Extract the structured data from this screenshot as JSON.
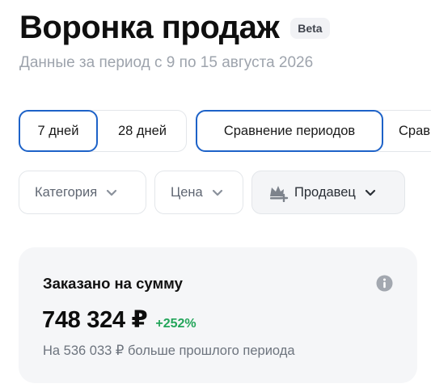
{
  "header": {
    "title": "Воронка продаж",
    "badge": "Beta",
    "subtitle": "Данные за период с 9 по 15 августа 2026"
  },
  "periods": {
    "group1": [
      {
        "label": "7 дней",
        "active": true
      },
      {
        "label": "28 дней",
        "active": false
      }
    ],
    "group2": [
      {
        "label": "Сравнение периодов",
        "active": true
      },
      {
        "label": "Сравнение",
        "active": false
      }
    ]
  },
  "filters": [
    {
      "label": "Категория",
      "icon": "chevron-down-icon"
    },
    {
      "label": "Цена",
      "icon": "chevron-down-icon"
    },
    {
      "label": "Продавец",
      "icon": "chevron-down-icon",
      "leading_icon": "seller-crown-icon"
    }
  ],
  "metric_card": {
    "title": "Заказано на сумму",
    "value": "748 324 ₽",
    "delta": "+252%",
    "comparison": "На 536 033 ₽ больше прошлого периода",
    "info_icon": "info-icon"
  },
  "colors": {
    "accent": "#1d62c8",
    "positive": "#23a55a",
    "muted_text": "#9ea4ad",
    "card_bg": "#f5f6f8"
  }
}
